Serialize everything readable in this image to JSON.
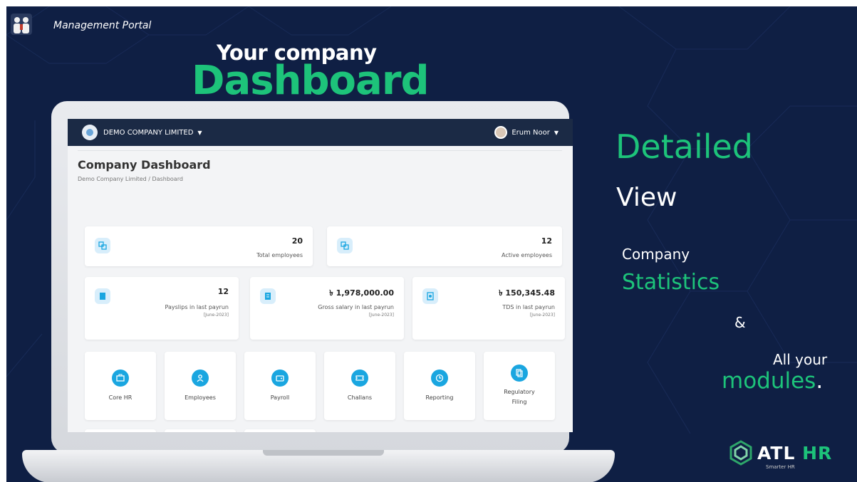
{
  "portal": {
    "label": "Management Portal",
    "logo_icon": "people-logo-icon"
  },
  "headline": {
    "line1": "Your company",
    "line2": "Dashboard"
  },
  "app": {
    "company": "DEMO COMPANY LIMITED",
    "user": "Erum Noor",
    "page_title": "Company Dashboard",
    "breadcrumb": "Demo Company Limited / Dashboard"
  },
  "stats_top": [
    {
      "value": "20",
      "label": "Total employees",
      "icon": "employees-icon"
    },
    {
      "value": "12",
      "label": "Active employees",
      "icon": "employees-icon"
    }
  ],
  "stats_mid": [
    {
      "value": "12",
      "label": "Payslips in last payrun",
      "sub": "[June-2023]",
      "icon": "payslip-icon"
    },
    {
      "value": "৳ 1,978,000.00",
      "label": "Gross salary in last payrun",
      "sub": "[June-2023]",
      "icon": "salary-icon"
    },
    {
      "value": "৳ 150,345.48",
      "label": "TDS in last payrun",
      "sub": "[June-2023]",
      "icon": "tds-icon"
    }
  ],
  "modules": [
    {
      "label": "Core HR",
      "icon": "briefcase-icon"
    },
    {
      "label": "Employees",
      "icon": "person-icon"
    },
    {
      "label": "Payroll",
      "icon": "wallet-icon"
    },
    {
      "label": "Challans",
      "icon": "ticket-icon"
    },
    {
      "label": "Reporting",
      "icon": "clock-icon"
    },
    {
      "label": "Regulatory Filing",
      "icon": "document-icon"
    }
  ],
  "side": {
    "detailed": "Detailed",
    "view": "View",
    "company": "Company",
    "statistics": "Statistics",
    "amp": "&",
    "all_your": "All your",
    "modules": "modules",
    "dot": "."
  },
  "brand": {
    "name_a": "ATL",
    "name_b": "HR",
    "tagline": "Smarter HR"
  },
  "colors": {
    "background": "#0f1f44",
    "accent_green": "#1dc37a",
    "app_bar": "#1b2a45",
    "module_icon": "#1aa6e0"
  }
}
